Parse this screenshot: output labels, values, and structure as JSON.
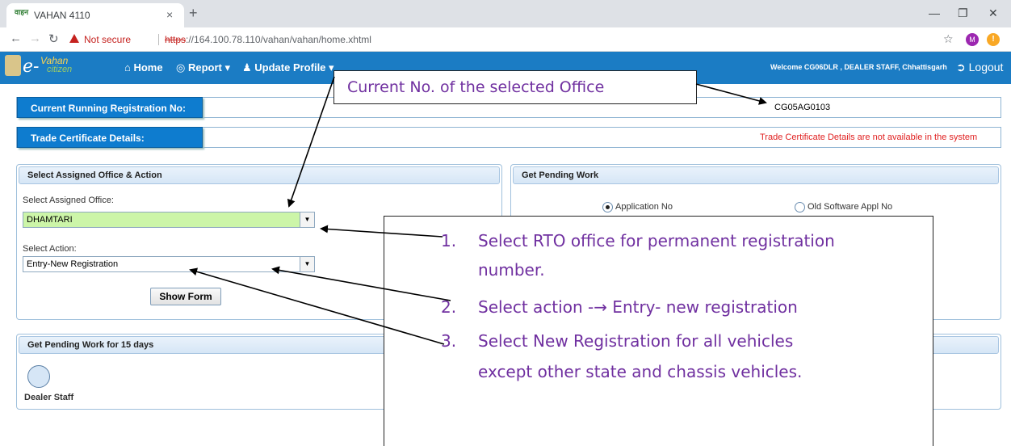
{
  "browser": {
    "tab_title": "VAHAN 4110",
    "tab_favicon_text": "वाहन",
    "tab_close": "×",
    "new_tab": "+",
    "security_label": "Not secure",
    "url_scheme": "https",
    "url_rest": "://164.100.78.110/vahan/vahan/home.xhtml",
    "avatar_letter": "M",
    "ext_glyph": "!"
  },
  "app": {
    "logo_e": "e-",
    "logo_vahan": "Vahan",
    "logo_sub": "citizen",
    "nav": {
      "home": "Home",
      "report": "Report ▾",
      "update_profile": "Update Profile ▾"
    },
    "welcome": "Welcome CG06DLR , DEALER STAFF, Chhattisgarh",
    "logout": "Logout"
  },
  "info": {
    "current_running_label": "Current Running Registration No:",
    "current_running_value": "CG05AG0103",
    "trade_cert_label": "Trade Certificate Details:",
    "trade_cert_value": "Trade Certificate Details are not available in the system"
  },
  "assigned_panel": {
    "title": "Select Assigned Office & Action",
    "office_label": "Select Assigned Office:",
    "office_value": "DHAMTARI",
    "action_label": "Select Action:",
    "action_value": "Entry-New Registration",
    "show_form": "Show Form"
  },
  "pending_panel": {
    "title": "Get Pending Work",
    "radio_application": "Application No",
    "radio_old": "Old Software Appl No"
  },
  "pending15": {
    "title": "Get Pending Work for 15 days",
    "dealer_label": "Dealer Staff"
  },
  "annotations": {
    "callout_top": "Current No. of the selected Office",
    "step1_num": "1.",
    "step1_line1": "Select RTO office for permanent registration",
    "step1_line2": "number.",
    "step2_num": "2.",
    "step2": "Select action -→ Entry- new registration",
    "step3_num": "3.",
    "step3_line1": "Select New Registration for all vehicles",
    "step3_line2": "except other state and chassis vehicles."
  },
  "colors": {
    "navbar": "#1b7cc4",
    "label_blue": "#0e7ccf",
    "annotation_text": "#7030a0",
    "warning_red": "#e02020",
    "office_select_bg": "#ccf5a8"
  }
}
